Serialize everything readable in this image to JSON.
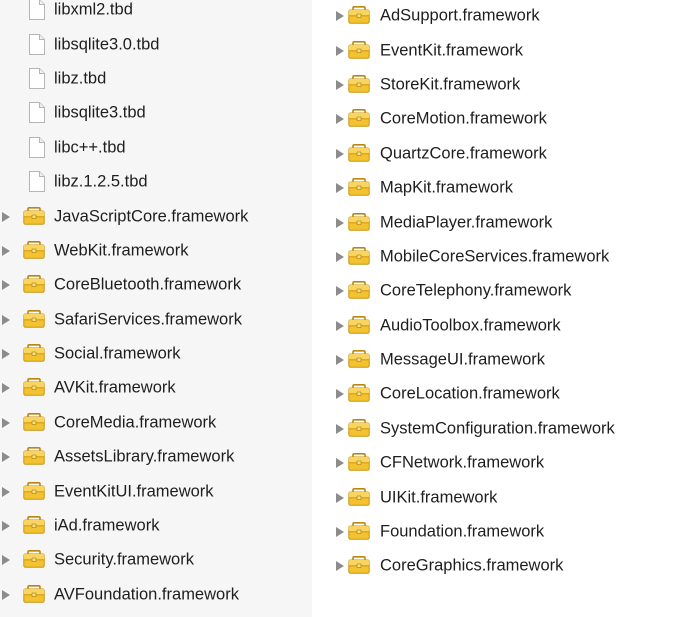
{
  "left_column": {
    "files": [
      {
        "name": "libxml2.tbd"
      },
      {
        "name": "libsqlite3.0.tbd"
      },
      {
        "name": "libz.tbd"
      },
      {
        "name": "libsqlite3.tbd"
      },
      {
        "name": "libc++.tbd"
      },
      {
        "name": "libz.1.2.5.tbd"
      }
    ],
    "frameworks": [
      {
        "name": "JavaScriptCore.framework"
      },
      {
        "name": "WebKit.framework"
      },
      {
        "name": "CoreBluetooth.framework"
      },
      {
        "name": "SafariServices.framework"
      },
      {
        "name": "Social.framework"
      },
      {
        "name": "AVKit.framework"
      },
      {
        "name": "CoreMedia.framework"
      },
      {
        "name": "AssetsLibrary.framework"
      },
      {
        "name": "EventKitUI.framework"
      },
      {
        "name": "iAd.framework"
      },
      {
        "name": "Security.framework"
      },
      {
        "name": "AVFoundation.framework"
      }
    ]
  },
  "right_column": {
    "frameworks": [
      {
        "name": "AdSupport.framework"
      },
      {
        "name": "EventKit.framework"
      },
      {
        "name": "StoreKit.framework"
      },
      {
        "name": "CoreMotion.framework"
      },
      {
        "name": "QuartzCore.framework"
      },
      {
        "name": "MapKit.framework"
      },
      {
        "name": "MediaPlayer.framework"
      },
      {
        "name": "MobileCoreServices.framework"
      },
      {
        "name": "CoreTelephony.framework"
      },
      {
        "name": "AudioToolbox.framework"
      },
      {
        "name": "MessageUI.framework"
      },
      {
        "name": "CoreLocation.framework"
      },
      {
        "name": "SystemConfiguration.framework"
      },
      {
        "name": "CFNetwork.framework"
      },
      {
        "name": "UIKit.framework"
      },
      {
        "name": "Foundation.framework"
      },
      {
        "name": "CoreGraphics.framework"
      }
    ]
  },
  "icons": {
    "file": "document-icon",
    "framework": "toolbox-folder-icon",
    "disclosure": "disclosure-triangle-icon"
  },
  "colors": {
    "left_background": "#f6f6f6",
    "right_background": "#ffffff",
    "folder_body": "#f2c230",
    "folder_tab": "#e0a81c",
    "triangle": "#8c8c8c",
    "text": "#1e1e1e"
  }
}
